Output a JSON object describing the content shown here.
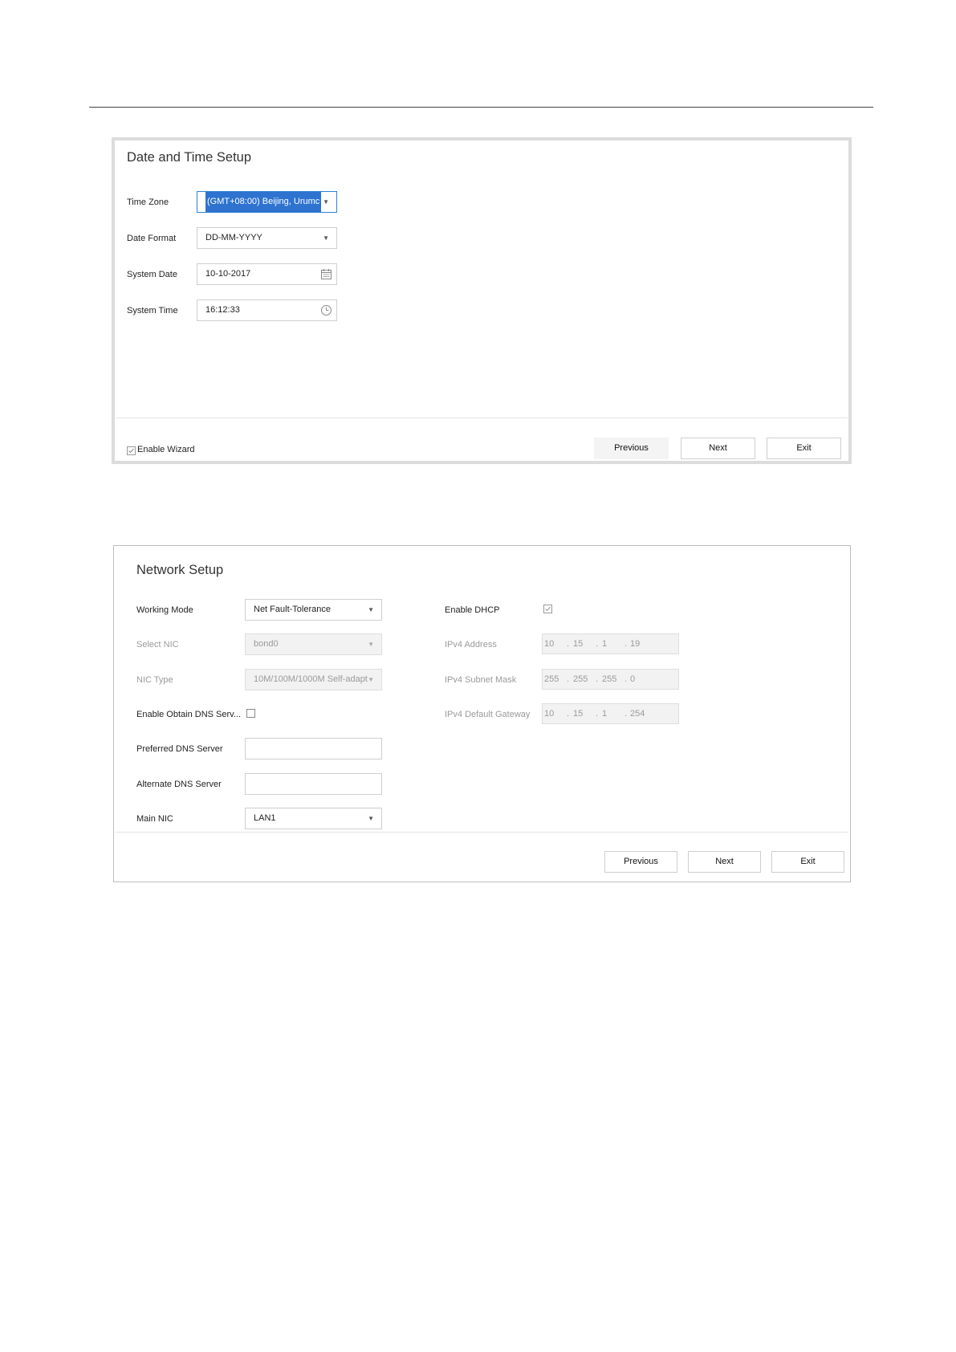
{
  "date_time_setup": {
    "title": "Date and Time Setup",
    "time_zone": {
      "label": "Time Zone",
      "value": "(GMT+08:00) Beijing, Urumc"
    },
    "date_format": {
      "label": "Date Format",
      "value": "DD-MM-YYYY"
    },
    "system_date": {
      "label": "System Date",
      "value": "10-10-2017"
    },
    "system_time": {
      "label": "System Time",
      "value": "16:12:33"
    },
    "enable_wizard": {
      "label": "Enable Wizard",
      "checked": true
    },
    "buttons": {
      "previous": "Previous",
      "next": "Next",
      "exit": "Exit"
    }
  },
  "network_setup": {
    "title": "Network Setup",
    "working_mode": {
      "label": "Working Mode",
      "value": "Net Fault-Tolerance"
    },
    "select_nic": {
      "label": "Select NIC",
      "value": "bond0"
    },
    "nic_type": {
      "label": "NIC Type",
      "value": "10M/100M/1000M Self-adapt"
    },
    "enable_obtain_dns": {
      "label": "Enable Obtain DNS Serv...",
      "checked": false
    },
    "preferred_dns": {
      "label": "Preferred DNS Server",
      "value": ""
    },
    "alternate_dns": {
      "label": "Alternate DNS Server",
      "value": ""
    },
    "main_nic": {
      "label": "Main NIC",
      "value": "LAN1"
    },
    "enable_dhcp": {
      "label": "Enable DHCP",
      "checked": true
    },
    "ipv4_address": {
      "label": "IPv4 Address",
      "octets": [
        "10",
        "15",
        "1",
        "19"
      ]
    },
    "ipv4_subnet_mask": {
      "label": "IPv4 Subnet Mask",
      "octets": [
        "255",
        "255",
        "255",
        "0"
      ]
    },
    "ipv4_default_gateway": {
      "label": "IPv4 Default Gateway",
      "octets": [
        "10",
        "15",
        "1",
        "254"
      ]
    },
    "buttons": {
      "previous": "Previous",
      "next": "Next",
      "exit": "Exit"
    }
  }
}
